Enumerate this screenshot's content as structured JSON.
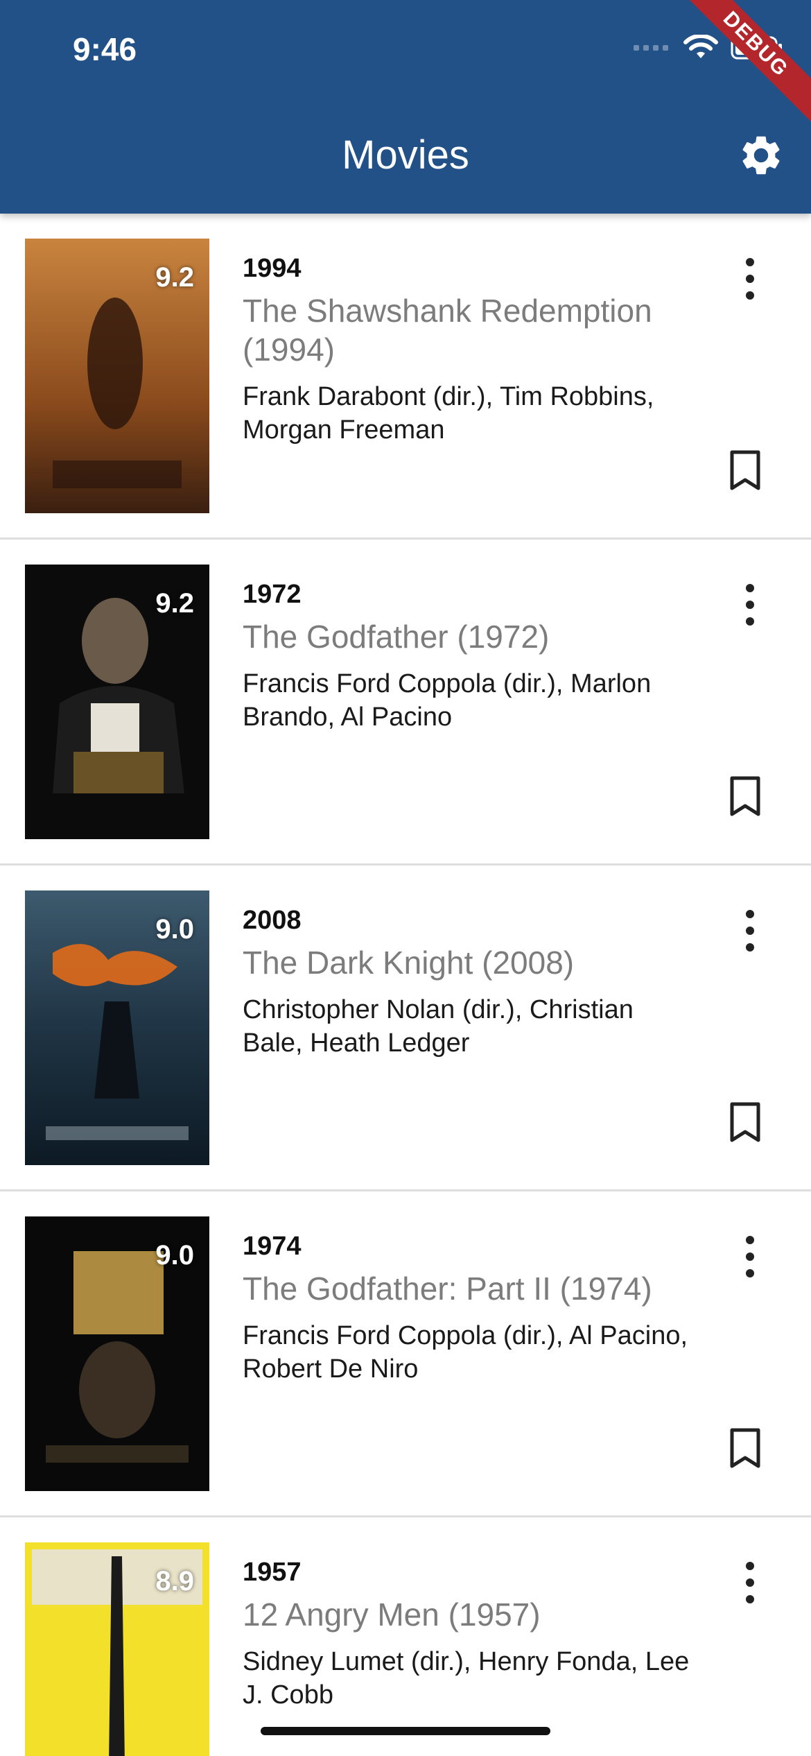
{
  "status_bar": {
    "time": "9:46"
  },
  "app_bar": {
    "title": "Movies",
    "settings_icon": "gear-icon",
    "debug_banner": "DEBUG"
  },
  "colors": {
    "app_bar": "#225188",
    "title_text": "#7c7c7c",
    "divider": "#dedede"
  },
  "movies": [
    {
      "year": "1994",
      "title": "The Shawshank Redemption (1994)",
      "credits": "Frank Darabont (dir.), Tim Robbins, Morgan Freeman",
      "rating": "9.2"
    },
    {
      "year": "1972",
      "title": "The Godfather (1972)",
      "credits": "Francis Ford Coppola (dir.), Marlon Brando, Al Pacino",
      "rating": "9.2"
    },
    {
      "year": "2008",
      "title": "The Dark Knight (2008)",
      "credits": "Christopher Nolan (dir.), Christian Bale, Heath Ledger",
      "rating": "9.0"
    },
    {
      "year": "1974",
      "title": "The Godfather: Part II (1974)",
      "credits": "Francis Ford Coppola (dir.), Al Pacino, Robert De Niro",
      "rating": "9.0"
    },
    {
      "year": "1957",
      "title": "12 Angry Men (1957)",
      "credits": "Sidney Lumet (dir.), Henry Fonda, Lee J. Cobb",
      "rating": "8.9"
    }
  ]
}
